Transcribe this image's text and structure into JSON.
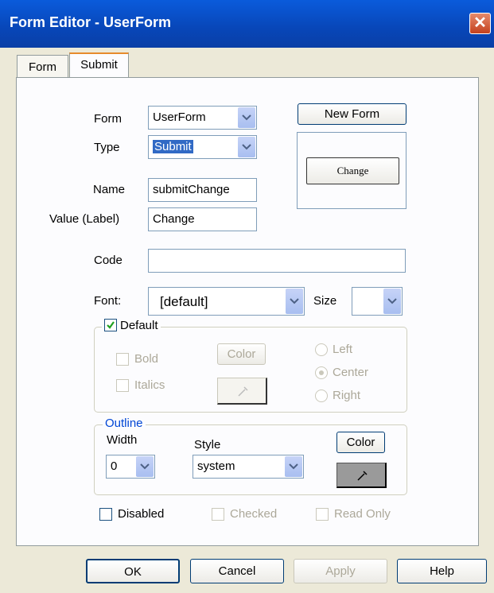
{
  "window": {
    "title": "Form Editor - UserForm",
    "close_glyph": "✕"
  },
  "tabs": {
    "form": "Form",
    "submit": "Submit"
  },
  "fields": {
    "form_label": "Form",
    "form_value": "UserForm",
    "type_label": "Type",
    "type_value": "Submit",
    "name_label": "Name",
    "name_value": "submitChange",
    "value_label": "Value (Label)",
    "value_value": "Change",
    "code_label": "Code",
    "code_value": "",
    "font_label": "Font:",
    "font_value": "[default]",
    "size_label": "Size",
    "size_value": ""
  },
  "preview": {
    "new_form": "New Form",
    "button_label": "Change"
  },
  "default_group": {
    "legend": "Default",
    "checked": true,
    "bold": "Bold",
    "italics": "Italics",
    "color": "Color",
    "left": "Left",
    "center": "Center",
    "right": "Right"
  },
  "outline_group": {
    "legend": "Outline",
    "width_label": "Width",
    "width_value": "0",
    "style_label": "Style",
    "style_value": "system",
    "color": "Color"
  },
  "states": {
    "disabled": "Disabled",
    "checked": "Checked",
    "read_only": "Read Only"
  },
  "footer": {
    "ok": "OK",
    "cancel": "Cancel",
    "apply": "Apply",
    "help": "Help"
  },
  "colors": {
    "title_bar": "#0846B8",
    "accent": "#316AC5",
    "dialog_bg": "#ECE9D8",
    "outline_legend": "#0046D5"
  }
}
